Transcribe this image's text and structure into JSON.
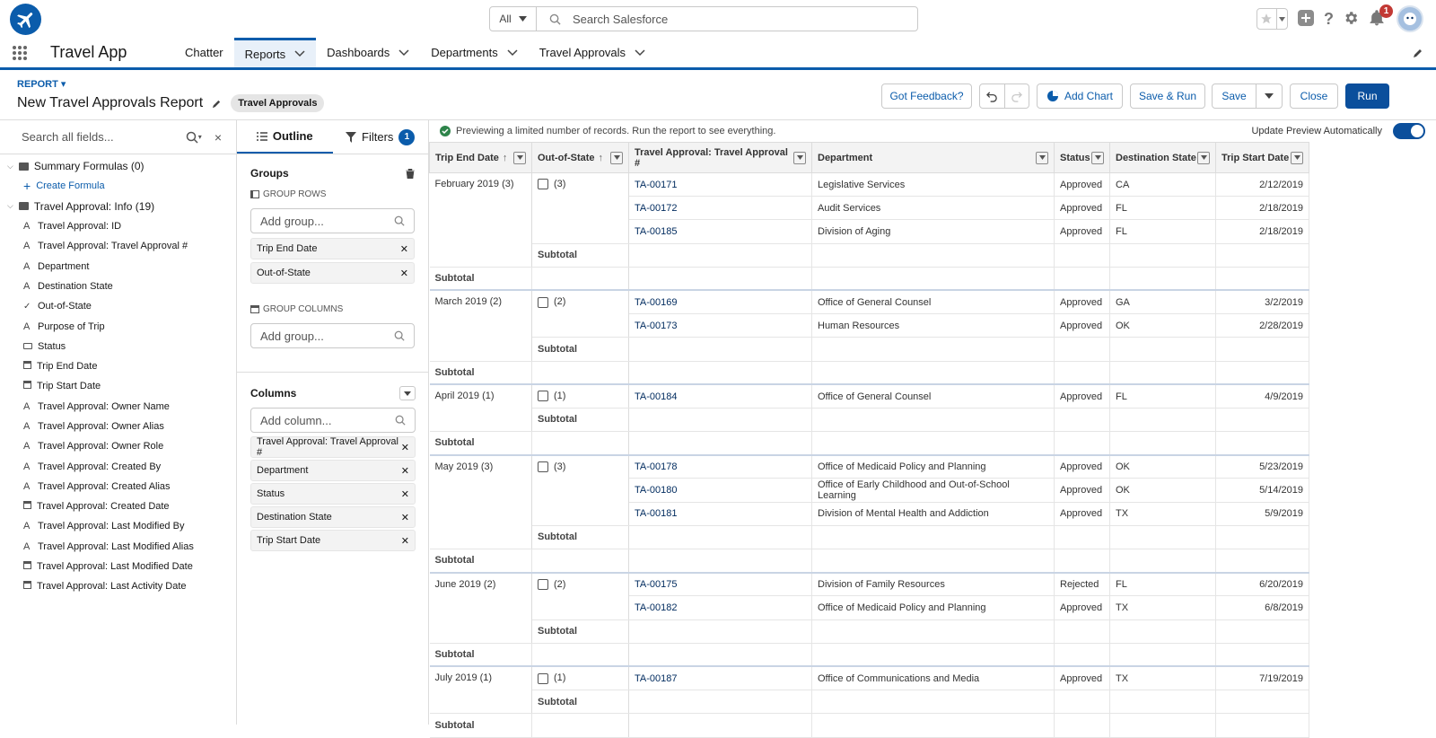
{
  "header": {
    "search_scope": "All",
    "search_placeholder": "Search Salesforce",
    "notification_count": "1"
  },
  "nav": {
    "app_name": "Travel App",
    "items": [
      {
        "label": "Chatter",
        "dropdown": false,
        "active": false
      },
      {
        "label": "Reports",
        "dropdown": true,
        "active": true
      },
      {
        "label": "Dashboards",
        "dropdown": true,
        "active": false
      },
      {
        "label": "Departments",
        "dropdown": true,
        "active": false
      },
      {
        "label": "Travel Approvals",
        "dropdown": true,
        "active": false
      }
    ]
  },
  "report": {
    "label": "REPORT",
    "title": "New Travel Approvals Report",
    "type_pill": "Travel Approvals",
    "buttons": {
      "feedback": "Got Feedback?",
      "add_chart": "Add Chart",
      "save_run": "Save & Run",
      "save": "Save",
      "close": "Close",
      "run": "Run"
    }
  },
  "fields": {
    "search_placeholder": "Search all fields...",
    "summary_formulas": "Summary Formulas (0)",
    "create_formula": "Create Formula",
    "folder": "Travel Approval: Info (19)",
    "items": [
      {
        "icon": "text",
        "label": "Travel Approval: ID"
      },
      {
        "icon": "text",
        "label": "Travel Approval: Travel Approval #"
      },
      {
        "icon": "text",
        "label": "Department"
      },
      {
        "icon": "text",
        "label": "Destination State"
      },
      {
        "icon": "check",
        "label": "Out-of-State"
      },
      {
        "icon": "text",
        "label": "Purpose of Trip"
      },
      {
        "icon": "picklist",
        "label": "Status"
      },
      {
        "icon": "date",
        "label": "Trip End Date"
      },
      {
        "icon": "date",
        "label": "Trip Start Date"
      },
      {
        "icon": "text",
        "label": "Travel Approval: Owner Name"
      },
      {
        "icon": "text",
        "label": "Travel Approval: Owner Alias"
      },
      {
        "icon": "text",
        "label": "Travel Approval: Owner Role"
      },
      {
        "icon": "text",
        "label": "Travel Approval: Created By"
      },
      {
        "icon": "text",
        "label": "Travel Approval: Created Alias"
      },
      {
        "icon": "date",
        "label": "Travel Approval: Created Date"
      },
      {
        "icon": "text",
        "label": "Travel Approval: Last Modified By"
      },
      {
        "icon": "text",
        "label": "Travel Approval: Last Modified Alias"
      },
      {
        "icon": "date",
        "label": "Travel Approval: Last Modified Date"
      },
      {
        "icon": "date",
        "label": "Travel Approval: Last Activity Date"
      }
    ]
  },
  "outline": {
    "tab_outline": "Outline",
    "tab_filters": "Filters",
    "filters_count": "1",
    "groups_title": "Groups",
    "group_rows_label": "GROUP ROWS",
    "add_group_placeholder": "Add group...",
    "group_rows": [
      "Trip End Date",
      "Out-of-State"
    ],
    "group_columns_label": "GROUP COLUMNS",
    "columns_title": "Columns",
    "add_column_placeholder": "Add column...",
    "columns": [
      "Travel Approval: Travel Approval #",
      "Department",
      "Status",
      "Destination State",
      "Trip Start Date"
    ]
  },
  "preview": {
    "info": "Previewing a limited number of records. Run the report to see everything.",
    "auto_update_label": "Update Preview Automatically",
    "auto_update_on": true,
    "subtotal_label": "Subtotal",
    "headers": [
      "Trip End Date",
      "Out-of-State",
      "Travel Approval: Travel Approval #",
      "Department",
      "Status",
      "Destination State",
      "Trip Start Date"
    ],
    "groups": [
      {
        "label": "February 2019 (3)",
        "oos": "(3)",
        "rows": [
          {
            "id": "TA-00171",
            "dept": "Legislative Services",
            "status": "Approved",
            "state": "CA",
            "start": "2/12/2019"
          },
          {
            "id": "TA-00172",
            "dept": "Audit Services",
            "status": "Approved",
            "state": "FL",
            "start": "2/18/2019"
          },
          {
            "id": "TA-00185",
            "dept": "Division of Aging",
            "status": "Approved",
            "state": "FL",
            "start": "2/18/2019"
          }
        ]
      },
      {
        "label": "March 2019 (2)",
        "oos": "(2)",
        "rows": [
          {
            "id": "TA-00169",
            "dept": "Office of General Counsel",
            "status": "Approved",
            "state": "GA",
            "start": "3/2/2019"
          },
          {
            "id": "TA-00173",
            "dept": "Human Resources",
            "status": "Approved",
            "state": "OK",
            "start": "2/28/2019"
          }
        ]
      },
      {
        "label": "April 2019 (1)",
        "oos": "(1)",
        "rows": [
          {
            "id": "TA-00184",
            "dept": "Office of General Counsel",
            "status": "Approved",
            "state": "FL",
            "start": "4/9/2019"
          }
        ]
      },
      {
        "label": "May 2019 (3)",
        "oos": "(3)",
        "rows": [
          {
            "id": "TA-00178",
            "dept": "Office of Medicaid Policy and Planning",
            "status": "Approved",
            "state": "OK",
            "start": "5/23/2019"
          },
          {
            "id": "TA-00180",
            "dept": "Office of Early Childhood and Out-of-School Learning",
            "status": "Approved",
            "state": "OK",
            "start": "5/14/2019"
          },
          {
            "id": "TA-00181",
            "dept": "Division of Mental Health and Addiction",
            "status": "Approved",
            "state": "TX",
            "start": "5/9/2019"
          }
        ]
      },
      {
        "label": "June 2019 (2)",
        "oos": "(2)",
        "rows": [
          {
            "id": "TA-00175",
            "dept": "Division of Family Resources",
            "status": "Rejected",
            "state": "FL",
            "start": "6/20/2019"
          },
          {
            "id": "TA-00182",
            "dept": "Office of Medicaid Policy and Planning",
            "status": "Approved",
            "state": "TX",
            "start": "6/8/2019"
          }
        ]
      },
      {
        "label": "July 2019 (1)",
        "oos": "(1)",
        "rows": [
          {
            "id": "TA-00187",
            "dept": "Office of Communications and Media",
            "status": "Approved",
            "state": "TX",
            "start": "7/19/2019"
          }
        ]
      }
    ]
  }
}
